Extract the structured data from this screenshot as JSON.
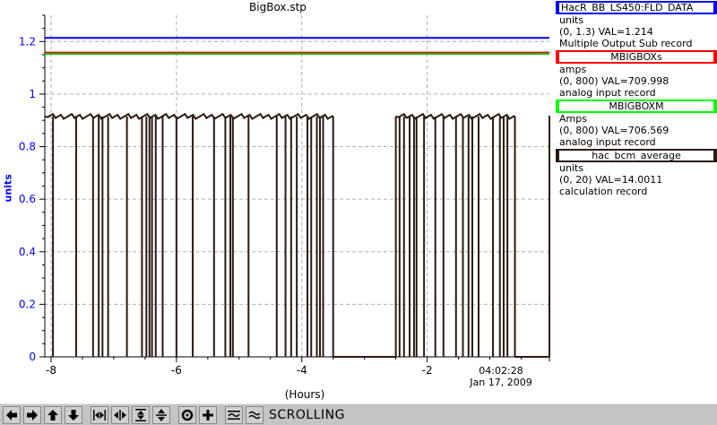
{
  "title": "BigBox.stp",
  "chart_data": {
    "type": "line",
    "title": "BigBox.stp",
    "xlabel": "(Hours)",
    "ylabel": "units",
    "xlim": [
      -8.1,
      -0.05
    ],
    "ylim": [
      0,
      1.3
    ],
    "x_ticks": [
      -8,
      -6,
      -4,
      -2
    ],
    "y_ticks": [
      0,
      0.2,
      0.4,
      0.6,
      0.8,
      1,
      1.2
    ],
    "grid": true,
    "end_time": "04:02:28",
    "end_date": "Jan 17, 2009",
    "series": [
      {
        "name": "HacR_BB_LS450:FLD_DATA",
        "color": "#0000ff",
        "x": [
          -8.1,
          -0.05
        ],
        "y": [
          1.214,
          1.214
        ]
      },
      {
        "name": "MBIGBOXs",
        "color": "#ff0000",
        "x": [
          -8.1,
          -0.05
        ],
        "y": [
          1.158,
          1.158
        ]
      },
      {
        "name": "MBIGBOXM",
        "color": "#00cc00",
        "x": [
          -8.1,
          -0.05
        ],
        "y": [
          1.153,
          1.153
        ]
      },
      {
        "name": "hac_bcm_average",
        "color": "#2a1a14",
        "baseline_segments": [
          [
            -8.1,
            -3.5,
            0.915
          ],
          [
            -2.5,
            -0.6,
            0.915
          ],
          [
            -0.05,
            -0.05,
            0.915
          ]
        ],
        "zero_segments": [
          [
            -3.5,
            -2.5
          ],
          [
            -0.6,
            -0.05
          ]
        ],
        "dropouts": [
          -7.97,
          -7.6,
          -7.33,
          -7.24,
          -7.18,
          -7.09,
          -6.79,
          -6.55,
          -6.48,
          -6.43,
          -6.39,
          -6.33,
          -6.22,
          -6.0,
          -5.74,
          -5.4,
          -5.22,
          -5.14,
          -5.1,
          -4.85,
          -4.4,
          -4.26,
          -4.17,
          -4.08,
          -3.91,
          -3.85,
          -3.76,
          -3.71,
          -3.66,
          -2.44,
          -2.37,
          -2.28,
          -2.21,
          -2.17,
          -2.05,
          -1.87,
          -1.74,
          -1.54,
          -1.43,
          -1.34,
          -1.28,
          -1.18,
          -0.95,
          -0.84,
          -0.78,
          -0.72
        ]
      }
    ]
  },
  "legend": [
    {
      "name": "HacR_BB_LS450:FLD_DATA",
      "color": "#0000ff",
      "units": "units",
      "range": "(0, 1.3) VAL=1.214",
      "record": "Multiple Output Sub record"
    },
    {
      "name": "MBIGBOXs",
      "color": "#ff0000",
      "units": "amps",
      "range": "(0, 800) VAL=709.998",
      "record": "analog input record"
    },
    {
      "name": "MBIGBOXM",
      "color": "#00ff00",
      "units": "Amps",
      "range": "(0, 800) VAL=706.569",
      "record": "analog input record"
    },
    {
      "name": "hac_bcm_average",
      "color": "#2a1a14",
      "units": "units",
      "range": "(0, 20) VAL=14.0011",
      "record": "calculation record"
    }
  ],
  "toolbar": {
    "mode": "SCROLLING",
    "buttons": [
      "arrow-left-icon",
      "arrow-right-icon",
      "arrow-up-icon",
      "arrow-down-icon",
      "zoom-in-horizontal-icon",
      "zoom-out-horizontal-icon",
      "zoom-in-vertical-icon",
      "zoom-out-vertical-icon",
      "cursor-icon",
      "crosshair-icon",
      "autoscale-icon",
      "pan-icon"
    ]
  }
}
